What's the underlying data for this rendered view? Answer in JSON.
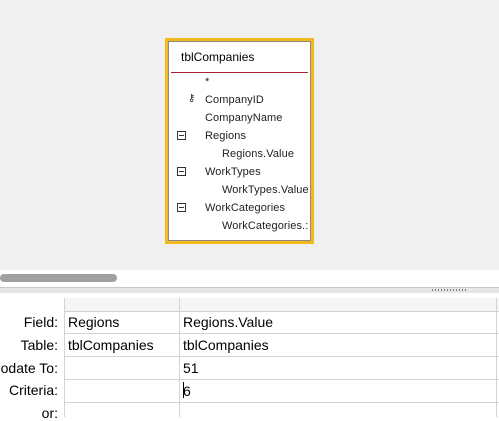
{
  "diagram": {
    "table_name": "tblCompanies",
    "fields": [
      {
        "label": "*",
        "type": "plain"
      },
      {
        "label": "CompanyID",
        "type": "key"
      },
      {
        "label": "CompanyName",
        "type": "plain"
      },
      {
        "label": "Regions",
        "type": "multivalue"
      },
      {
        "label": "Regions.Value",
        "type": "child"
      },
      {
        "label": "WorkTypes",
        "type": "multivalue"
      },
      {
        "label": "WorkTypes.Value",
        "type": "child"
      },
      {
        "label": "WorkCategories",
        "type": "multivalue"
      },
      {
        "label": "WorkCategories.:",
        "type": "child"
      }
    ]
  },
  "grid": {
    "row_labels": {
      "field": "Field:",
      "table": "Table:",
      "update_to": "odate To:",
      "criteria": "Criteria:",
      "or": "or:"
    },
    "columns": [
      {
        "field": "Regions",
        "table": "tblCompanies",
        "update_to": "",
        "criteria": ""
      },
      {
        "field": "Regions.Value",
        "table": "tblCompanies",
        "update_to": "51",
        "criteria": "6"
      }
    ]
  },
  "colors": {
    "selection_border": "#f3b91c",
    "title_underline": "#a4262c",
    "pane_background": "#f0f0f0"
  }
}
